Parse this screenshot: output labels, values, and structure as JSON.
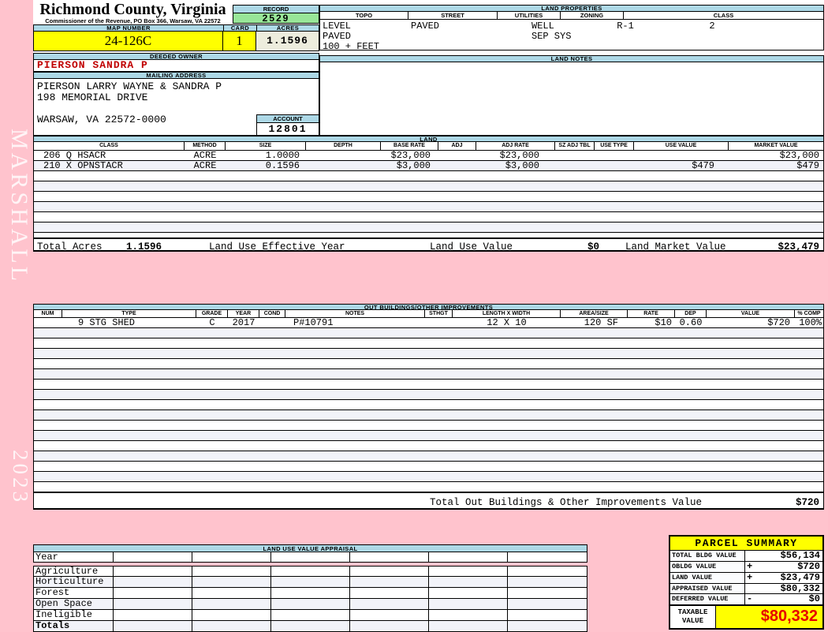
{
  "sidebar": {
    "top_text": "MARSHALL",
    "bottom_text": "2023"
  },
  "header": {
    "county": "Richmond County, Virginia",
    "subtitle": "Commissioner of the Revenue, PO Box 366, Warsaw, VA 22572",
    "record_label": "RECORD",
    "record_value": "2529",
    "map_number_label": "MAP NUMBER",
    "map_number": "24-126C",
    "card_label": "CARD",
    "card": "1",
    "acres_label": "ACRES",
    "acres": "1.1596",
    "deeded_owner_label": "DEEDED OWNER",
    "deeded_owner": "PIERSON SANDRA P",
    "mailing_address_label": "MAILING ADDRESS",
    "mailing_lines": [
      "PIERSON LARRY WAYNE & SANDRA P",
      "198 MEMORIAL DRIVE",
      "",
      "WARSAW, VA 22572-0000"
    ],
    "account_label": "ACCOUNT",
    "account": "12801"
  },
  "land_properties": {
    "title": "LAND PROPERTIES",
    "columns": [
      "TOPO",
      "STREET",
      "UTILITIES",
      "ZONING",
      "CLASS"
    ],
    "topo": [
      "LEVEL",
      "PAVED",
      "100 + FEET"
    ],
    "street": [
      "PAVED"
    ],
    "utilities": [
      "WELL",
      "SEP SYS"
    ],
    "zoning": "R-1",
    "class": "2",
    "notes_label": "LAND NOTES"
  },
  "land": {
    "title": "LAND",
    "columns": [
      "CLASS",
      "METHOD",
      "SIZE",
      "DEPTH",
      "BASE RATE",
      "ADJ",
      "ADJ RATE",
      "SZ ADJ TBL",
      "USE TYPE",
      "USE VALUE",
      "MARKET VALUE"
    ],
    "rows": [
      [
        "206 Q HSACR",
        "ACRE",
        "1.0000",
        "",
        "$23,000",
        "",
        "$23,000",
        "",
        "",
        "",
        "$23,000"
      ],
      [
        "210 X OPNSTACR",
        "ACRE",
        "0.1596",
        "",
        "$3,000",
        "",
        "$3,000",
        "",
        "",
        "$479",
        "$479"
      ]
    ],
    "totals": {
      "total_acres_label": "Total Acres",
      "total_acres": "1.1596",
      "effective_year_label": "Land Use Effective Year",
      "use_value_label": "Land Use Value",
      "use_value": "$0",
      "market_value_label": "Land Market Value",
      "market_value": "$23,479"
    }
  },
  "out_buildings": {
    "title": "OUT BUILDINGS/OTHER IMPROVEMENTS",
    "columns": [
      "NUM",
      "TYPE",
      "GRADE",
      "YEAR",
      "COND",
      "NOTES",
      "STHGT",
      "LENGTH X WIDTH",
      "AREA/SIZE",
      "RATE",
      "DEP",
      "VALUE",
      "% COMP"
    ],
    "rows": [
      [
        "",
        "9 STG SHED",
        "C",
        "2017",
        "",
        "P#10791",
        "",
        "12 X 10",
        "120 SF",
        "$10",
        "0.60",
        "$720",
        "100%"
      ]
    ],
    "total_label": "Total Out Buildings & Other Improvements Value",
    "total_value": "$720"
  },
  "land_use_appraisal": {
    "title": "LAND USE VALUE APPRAISAL",
    "row_labels": [
      "Year",
      "Agriculture",
      "Horticulture",
      "Forest",
      "Open Space",
      "Ineligible",
      "Totals"
    ]
  },
  "parcel_summary": {
    "title": "PARCEL SUMMARY",
    "rows": [
      {
        "label": "TOTAL BLDG VALUE",
        "sign": "",
        "value": "$56,134"
      },
      {
        "label": "OBLDG VALUE",
        "sign": "+",
        "value": "$720"
      },
      {
        "label": "LAND VALUE",
        "sign": "+",
        "value": "$23,479"
      },
      {
        "label": "APPRAISED VALUE",
        "sign": "",
        "value": "$80,332"
      },
      {
        "label": "DEFERRED VALUE",
        "sign": "-",
        "value": "$0"
      }
    ],
    "taxable_label": "TAXABLE VALUE",
    "taxable_value": "$80,332"
  },
  "colors": {
    "page_pink": "#ffc3cd",
    "header_blue": "#add8e6",
    "record_green": "#98e698",
    "highlight_yellow": "#ffff00",
    "acres_beige": "#ededdd",
    "owner_red": "#c00000",
    "taxable_red": "#e60000",
    "row_tint": "#f2f3f9"
  }
}
